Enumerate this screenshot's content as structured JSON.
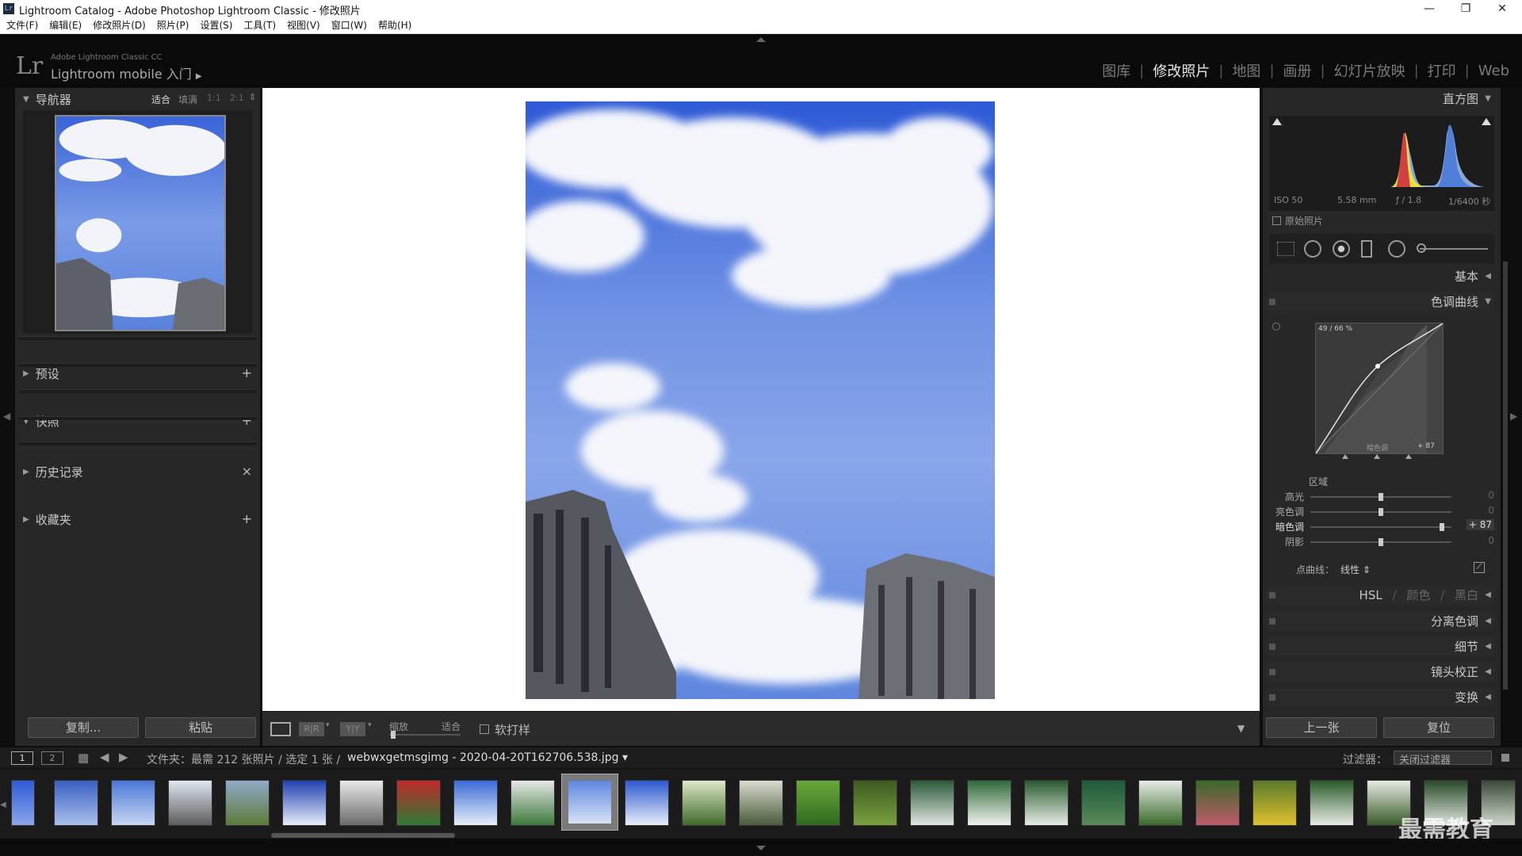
{
  "window": {
    "title": "Lightroom Catalog - Adobe Photoshop Lightroom Classic - 修改照片",
    "app_icon": "Lr"
  },
  "window_controls": {
    "minimize": "—",
    "maximize": "❐",
    "close": "✕"
  },
  "menu": [
    "文件(F)",
    "编辑(E)",
    "修改照片(D)",
    "照片(P)",
    "设置(S)",
    "工具(T)",
    "视图(V)",
    "窗口(W)",
    "帮助(H)"
  ],
  "brand": {
    "logo": "Lr",
    "line1": "Adobe Lightroom Classic CC",
    "line2": "Lightroom mobile 入门",
    "arrow": "▶"
  },
  "modules": [
    "图库",
    "修改照片",
    "地图",
    "画册",
    "幻灯片放映",
    "打印",
    "Web"
  ],
  "modules_separator": "|",
  "active_module": "修改照片",
  "left": {
    "navigator": {
      "title": "导航器",
      "zoom_options": [
        "适合",
        "填满",
        "1:1",
        "2:1"
      ],
      "active_zoom": "适合"
    },
    "panels": [
      {
        "label": "预设",
        "action": "+"
      },
      {
        "label": "快照",
        "action": "+"
      },
      {
        "label": "历史记录",
        "action": "×"
      },
      {
        "label": "收藏夹",
        "action": "+"
      }
    ],
    "copy_button": "复制...",
    "paste_button": "粘贴"
  },
  "toolbar": {
    "zoom_label": "缩放",
    "zoom_value": "适合",
    "softproof_label": "软打样",
    "compare_a": "R|R",
    "compare_b": "Y|Y"
  },
  "right": {
    "histogram_title": "直方图",
    "exif": [
      "ISO 50",
      "5.58 mm",
      "ƒ / 1.8",
      "1/6400 秒"
    ],
    "original_photo_label": "原始照片",
    "basic_label": "基本",
    "tone_curve_title": "色调曲线",
    "curve_readout": "49 / 66 %",
    "curve_channel": "暗色调",
    "curve_value": "+ 87",
    "region_label": "区域",
    "regions": [
      {
        "label": "高光",
        "value": "0",
        "level": 0.5
      },
      {
        "label": "亮色调",
        "value": "0",
        "level": 0.5
      },
      {
        "label": "暗色调",
        "value": "+ 87",
        "level": 0.935
      },
      {
        "label": "阴影",
        "value": "0",
        "level": 0.5
      }
    ],
    "point_curve_label": "点曲线：",
    "point_curve_value": "线性 ⇕",
    "hsl_tabs": [
      "HSL",
      "颜色",
      "黑白"
    ],
    "hsl_separator": "/",
    "sections": [
      "分离色调",
      "细节",
      "镜头校正",
      "变换"
    ],
    "prev_button": "上一张",
    "reset_button": "复位"
  },
  "filmbar": {
    "view_buttons": [
      "1",
      "2"
    ],
    "info": "文件夹：最需   212 张照片 / 选定 1 张 /",
    "filename": "webwxgetmsgimg - 2020-04-20T162706.538.jpg ▾",
    "filter_label": "过滤器：",
    "filter_value": "关闭过滤器"
  },
  "watermark": "最需教育",
  "colors": {
    "sky": "#5f86e0",
    "accent": "#e8e8e8"
  }
}
